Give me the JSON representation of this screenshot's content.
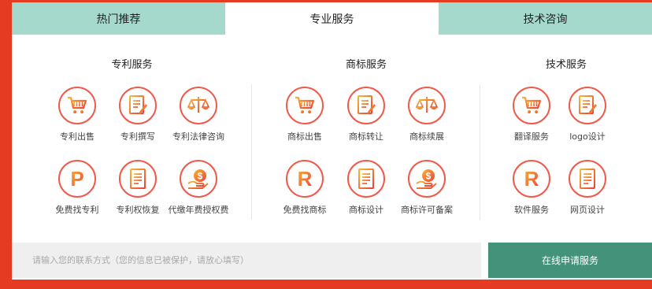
{
  "tabs": [
    {
      "label": "热门推荐",
      "active": false
    },
    {
      "label": "专业服务",
      "active": true
    },
    {
      "label": "技术咨询",
      "active": false
    }
  ],
  "columns": [
    {
      "title": "专利服务",
      "items": [
        {
          "label": "专利出售",
          "icon": "cart-icon"
        },
        {
          "label": "专利撰写",
          "icon": "document-edit-icon"
        },
        {
          "label": "专利法律咨询",
          "icon": "scale-icon"
        },
        {
          "label": "免费找专利",
          "icon": "letter-p-icon"
        },
        {
          "label": "专利权恢复",
          "icon": "document-icon"
        },
        {
          "label": "代缴年费授权费",
          "icon": "coin-hand-icon"
        }
      ]
    },
    {
      "title": "商标服务",
      "items": [
        {
          "label": "商标出售",
          "icon": "cart-icon"
        },
        {
          "label": "商标转让",
          "icon": "document-edit-icon"
        },
        {
          "label": "商标续展",
          "icon": "scale-icon"
        },
        {
          "label": "免费找商标",
          "icon": "letter-r-icon"
        },
        {
          "label": "商标设计",
          "icon": "document-icon"
        },
        {
          "label": "商标许可备案",
          "icon": "coin-hand-icon"
        }
      ]
    },
    {
      "title": "技术服务",
      "items": [
        {
          "label": "翻译服务",
          "icon": "cart-icon"
        },
        {
          "label": "logo设计",
          "icon": "document-edit-icon"
        },
        {
          "label": "软件服务",
          "icon": "letter-r-icon"
        },
        {
          "label": "网页设计",
          "icon": "document-icon"
        }
      ]
    }
  ],
  "contact": {
    "placeholder": "请输入您的联系方式（您的信息已被保护，请放心填写）",
    "submit_label": "在线申请服务"
  },
  "colors": {
    "background": "#e63b23",
    "tab_inactive": "#a5d9cb",
    "icon_border": "#ef5a4a",
    "icon_gradient_start": "#f7b733",
    "icon_gradient_end": "#ee4036",
    "submit_button": "#44927a"
  }
}
